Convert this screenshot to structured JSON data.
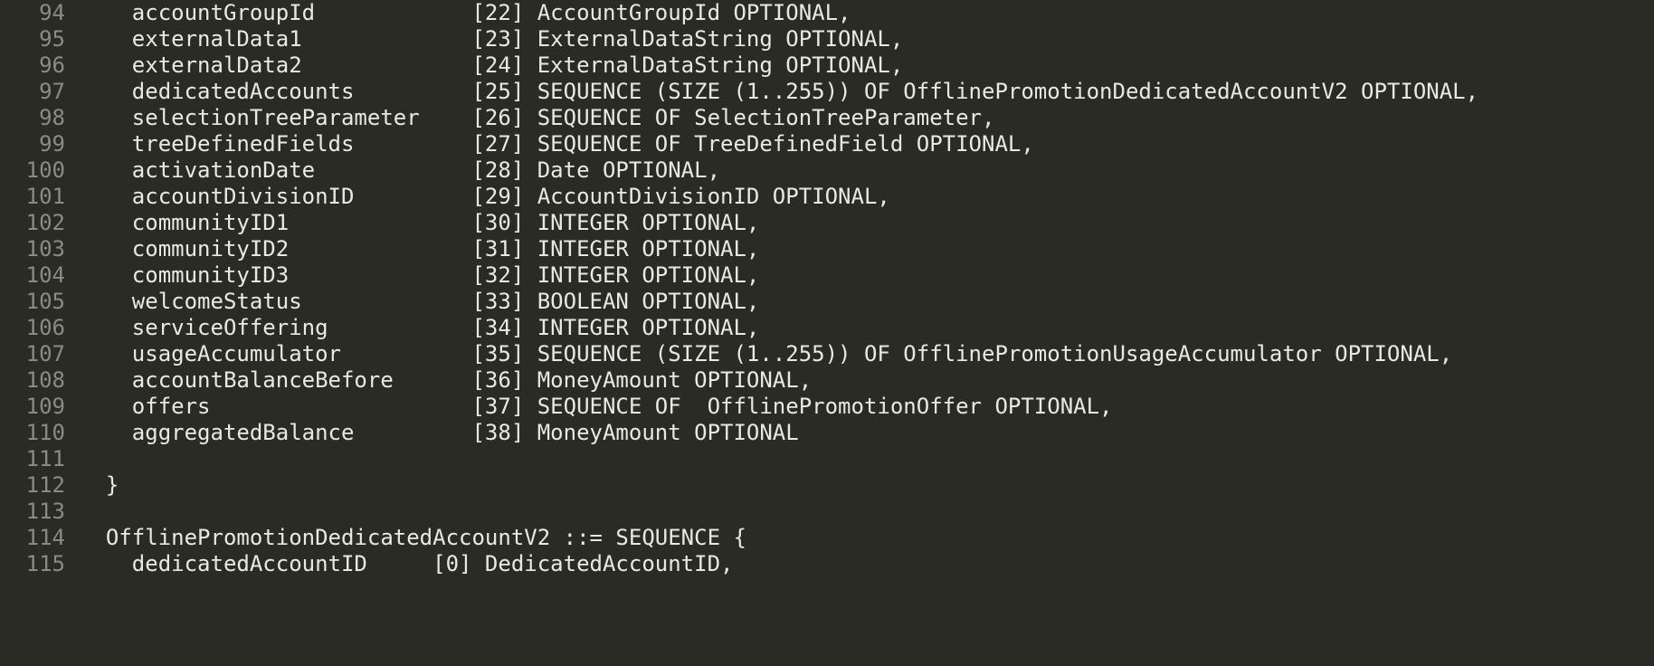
{
  "lines": [
    {
      "num": 94,
      "text": "    accountGroupId            [22] AccountGroupId OPTIONAL,"
    },
    {
      "num": 95,
      "text": "    externalData1             [23] ExternalDataString OPTIONAL,"
    },
    {
      "num": 96,
      "text": "    externalData2             [24] ExternalDataString OPTIONAL,"
    },
    {
      "num": 97,
      "text": "    dedicatedAccounts         [25] SEQUENCE (SIZE (1..255)) OF OfflinePromotionDedicatedAccountV2 OPTIONAL,"
    },
    {
      "num": 98,
      "text": "    selectionTreeParameter    [26] SEQUENCE OF SelectionTreeParameter,"
    },
    {
      "num": 99,
      "text": "    treeDefinedFields         [27] SEQUENCE OF TreeDefinedField OPTIONAL,"
    },
    {
      "num": 100,
      "text": "    activationDate            [28] Date OPTIONAL,"
    },
    {
      "num": 101,
      "text": "    accountDivisionID         [29] AccountDivisionID OPTIONAL,"
    },
    {
      "num": 102,
      "text": "    communityID1              [30] INTEGER OPTIONAL,"
    },
    {
      "num": 103,
      "text": "    communityID2              [31] INTEGER OPTIONAL,"
    },
    {
      "num": 104,
      "text": "    communityID3              [32] INTEGER OPTIONAL,"
    },
    {
      "num": 105,
      "text": "    welcomeStatus             [33] BOOLEAN OPTIONAL,"
    },
    {
      "num": 106,
      "text": "    serviceOffering           [34] INTEGER OPTIONAL,"
    },
    {
      "num": 107,
      "text": "    usageAccumulator          [35] SEQUENCE (SIZE (1..255)) OF OfflinePromotionUsageAccumulator OPTIONAL,"
    },
    {
      "num": 108,
      "text": "    accountBalanceBefore      [36] MoneyAmount OPTIONAL,"
    },
    {
      "num": 109,
      "text": "    offers                    [37] SEQUENCE OF  OfflinePromotionOffer OPTIONAL,"
    },
    {
      "num": 110,
      "text": "    aggregatedBalance         [38] MoneyAmount OPTIONAL"
    },
    {
      "num": 111,
      "text": ""
    },
    {
      "num": 112,
      "text": "  }"
    },
    {
      "num": 113,
      "text": ""
    },
    {
      "num": 114,
      "text": "  OfflinePromotionDedicatedAccountV2 ::= SEQUENCE {"
    },
    {
      "num": 115,
      "text": "    dedicatedAccountID     [0] DedicatedAccountID,"
    }
  ]
}
